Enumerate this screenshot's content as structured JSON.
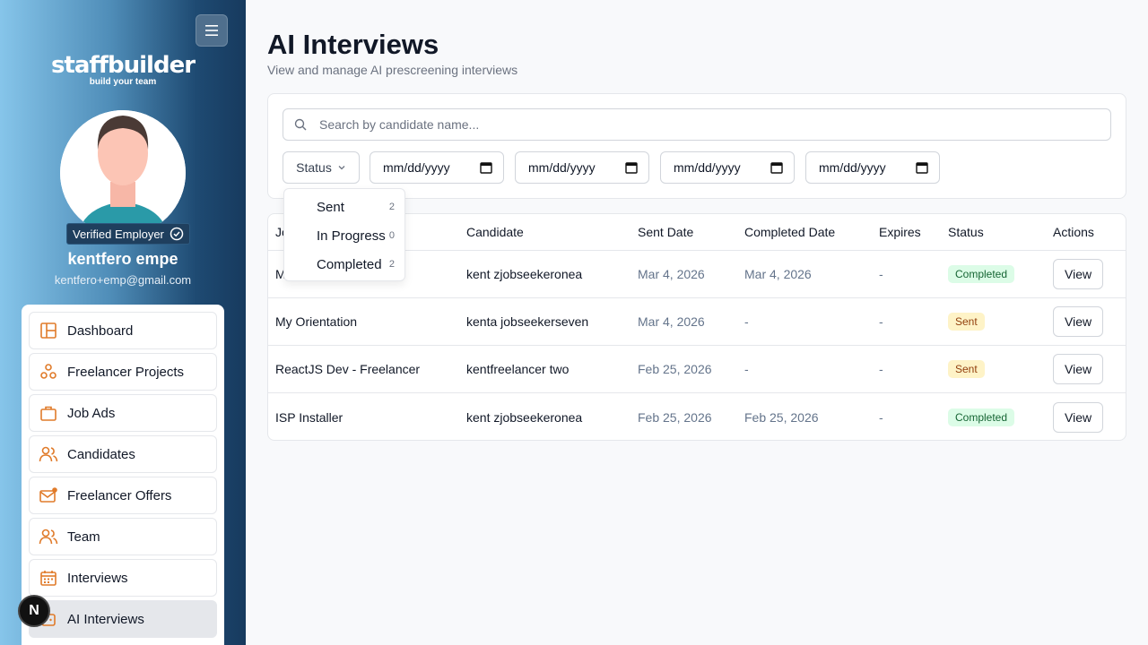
{
  "sidebar": {
    "brand": "staffbuilder",
    "tagline": "build your team",
    "verified_label": "Verified Employer",
    "user_name": "kentfero empe",
    "user_email": "kentfero+emp@gmail.com",
    "nav": [
      {
        "label": "Dashboard",
        "icon": "dashboard-icon"
      },
      {
        "label": "Freelancer Projects",
        "icon": "projects-icon"
      },
      {
        "label": "Job Ads",
        "icon": "briefcase-icon"
      },
      {
        "label": "Candidates",
        "icon": "users-icon"
      },
      {
        "label": "Freelancer Offers",
        "icon": "mail-icon"
      },
      {
        "label": "Team",
        "icon": "team-icon"
      },
      {
        "label": "Interviews",
        "icon": "calendar-icon"
      },
      {
        "label": "AI Interviews",
        "icon": "ai-icon",
        "active": true
      }
    ],
    "n_badge": "N"
  },
  "header": {
    "title": "AI Interviews",
    "subtitle": "View and manage AI prescreening interviews"
  },
  "filters": {
    "search_placeholder": "Search by candidate name...",
    "status_label": "Status",
    "date_placeholders": [
      "mm/dd/yyyy",
      "mm/dd/yyyy",
      "mm/dd/yyyy",
      "mm/dd/yyyy"
    ]
  },
  "status_dropdown": [
    {
      "label": "Sent",
      "count": "2"
    },
    {
      "label": "In Progress",
      "count": "0"
    },
    {
      "label": "Completed",
      "count": "2"
    }
  ],
  "table": {
    "columns": [
      "Jo",
      "Candidate",
      "Sent Date",
      "Completed Date",
      "Expires",
      "Status",
      "Actions"
    ],
    "rows": [
      {
        "job": "M",
        "candidate": "kent zjobseekeronea",
        "sent": "Mar 4, 2026",
        "completed": "Mar 4, 2026",
        "expires": "-",
        "status": "Completed",
        "action": "View"
      },
      {
        "job": "My Orientation",
        "candidate": "kenta jobseekerseven",
        "sent": "Mar 4, 2026",
        "completed": "-",
        "expires": "-",
        "status": "Sent",
        "action": "View"
      },
      {
        "job": "ReactJS Dev - Freelancer",
        "candidate": "kentfreelancer two",
        "sent": "Feb 25, 2026",
        "completed": "-",
        "expires": "-",
        "status": "Sent",
        "action": "View"
      },
      {
        "job": "ISP Installer",
        "candidate": "kent zjobseekeronea",
        "sent": "Feb 25, 2026",
        "completed": "Feb 25, 2026",
        "expires": "-",
        "status": "Completed",
        "action": "View"
      }
    ]
  },
  "colors": {
    "accent": "#e07b2a",
    "completed_badge": "#dcfce7",
    "sent_badge": "#fef3c7"
  }
}
